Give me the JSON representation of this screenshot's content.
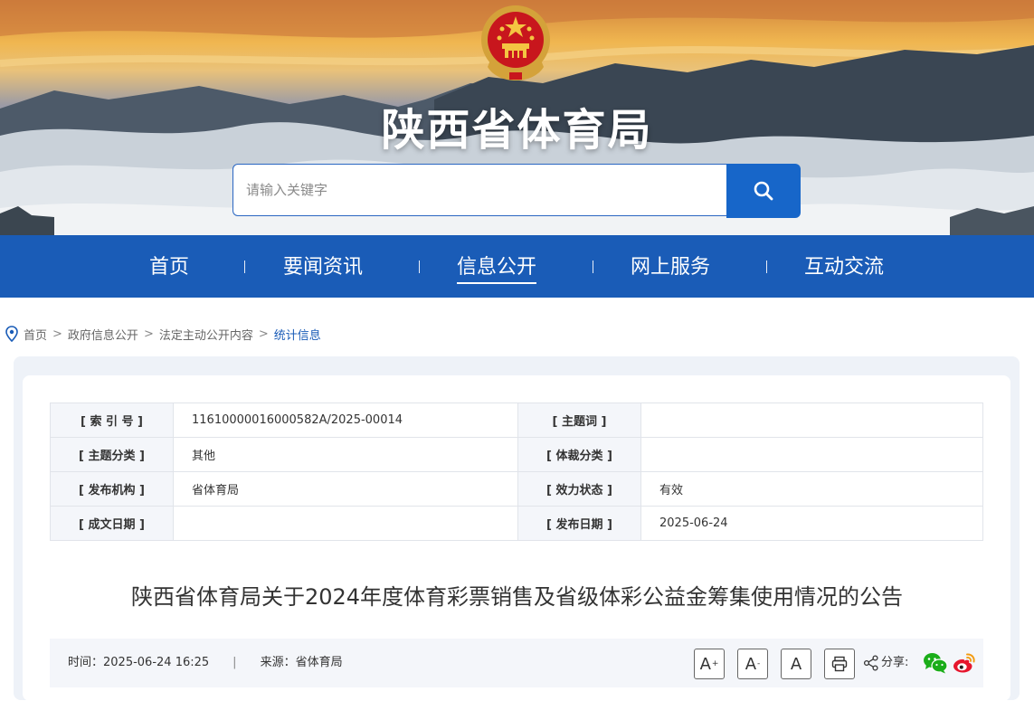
{
  "header": {
    "site_title": "陕西省体育局",
    "emblem": "national-emblem",
    "search": {
      "placeholder": "请输入关键字",
      "button_icon": "search-icon"
    }
  },
  "nav": {
    "items": [
      {
        "label": "首页",
        "active": false
      },
      {
        "label": "要闻资讯",
        "active": false
      },
      {
        "label": "信息公开",
        "active": true
      },
      {
        "label": "网上服务",
        "active": false
      },
      {
        "label": "互动交流",
        "active": false
      }
    ]
  },
  "breadcrumb": {
    "icon": "location-pin-icon",
    "items": [
      "首页",
      "政府信息公开",
      "法定主动公开内容",
      "统计信息"
    ],
    "separator": ">"
  },
  "meta_table": {
    "rows": [
      {
        "k1": "[ 索 引 号 ]",
        "v1": "11610000016000582A/2025-00014",
        "k2": "[ 主题词 ]",
        "v2": ""
      },
      {
        "k1": "[ 主题分类 ]",
        "v1": "其他",
        "k2": "[ 体裁分类 ]",
        "v2": ""
      },
      {
        "k1": "[ 发布机构 ]",
        "v1": "省体育局",
        "k2": "[ 效力状态 ]",
        "v2": "有效"
      },
      {
        "k1": "[ 成文日期 ]",
        "v1": "",
        "k2": "[ 发布日期 ]",
        "v2": "2025-06-24"
      }
    ]
  },
  "article": {
    "title": "陕西省体育局关于2024年度体育彩票销售及省级体彩公益金筹集使用情况的公告",
    "time_label": "时间：",
    "time_value": "2025-06-24 16:25",
    "divider": "|",
    "source_label": "来源：",
    "source_value": "省体育局",
    "font_buttons": [
      {
        "label": "A",
        "sup": "+"
      },
      {
        "label": "A",
        "sup": "-"
      },
      {
        "label": "A",
        "sup": ""
      }
    ],
    "print_icon": "print-icon",
    "share_icon": "share-icon",
    "share_label": "分享:",
    "share_targets": [
      "wechat-icon",
      "weibo-icon"
    ]
  },
  "colors": {
    "nav_bg": "#1a5cb7",
    "search_button": "#1766c9",
    "breadcrumb_current": "#1a5cb7",
    "card_bg": "#eef2f8"
  }
}
